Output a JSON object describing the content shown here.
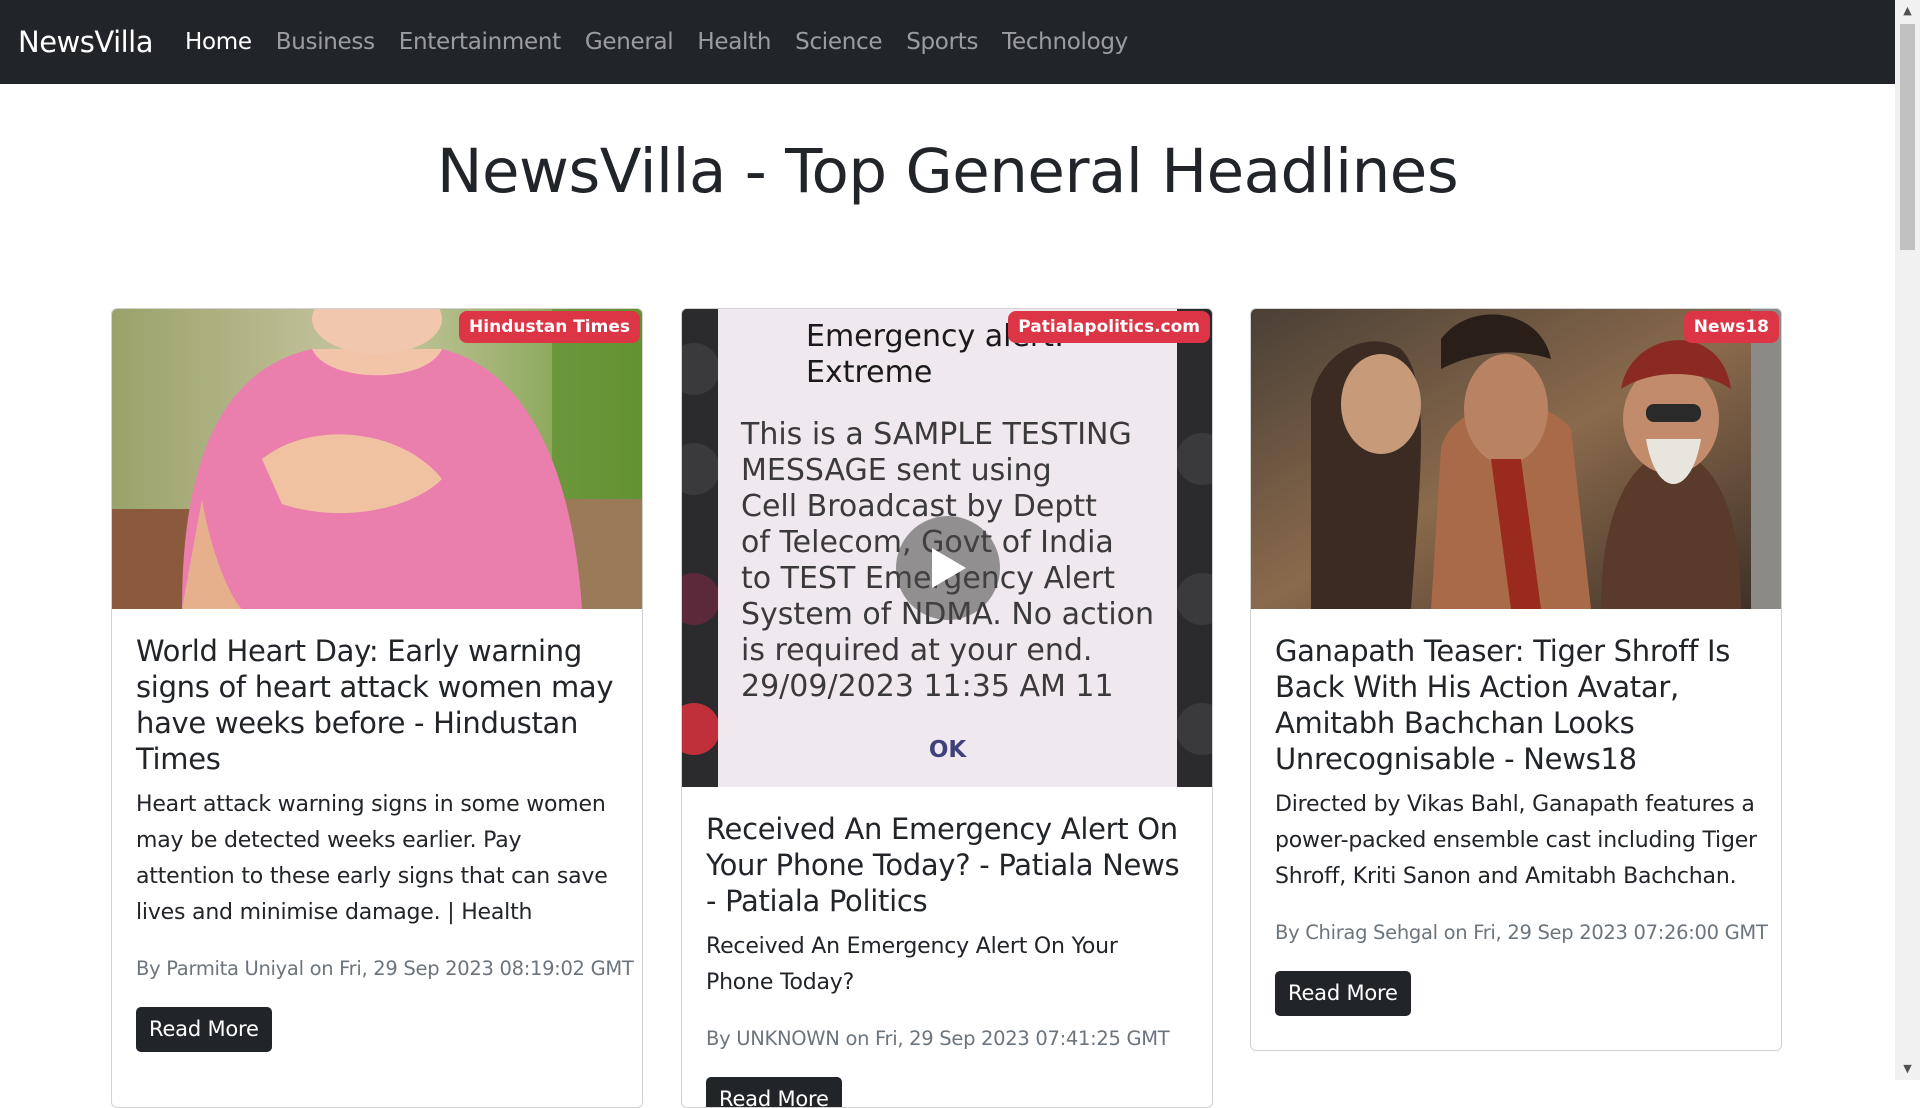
{
  "navbar": {
    "brand": "NewsVilla",
    "items": [
      {
        "label": "Home",
        "active": true
      },
      {
        "label": "Business"
      },
      {
        "label": "Entertainment"
      },
      {
        "label": "General"
      },
      {
        "label": "Health"
      },
      {
        "label": "Science"
      },
      {
        "label": "Sports"
      },
      {
        "label": "Technology"
      }
    ]
  },
  "page_title": "NewsVilla - Top General Headlines",
  "articles": [
    {
      "source": "Hindustan Times",
      "title": "World Heart Day: Early warning signs of heart attack women may have weeks before - Hindustan Times",
      "description": "Heart attack warning signs in some women may be detected weeks earlier. Pay attention to these early signs that can save lives and minimise damage. | Health",
      "meta": "By Parmita Uniyal on Fri, 29 Sep 2023 08:19:02 GMT",
      "button": "Read More"
    },
    {
      "source": "Patialapolitics.com",
      "title": "Received An Emergency Alert On Your Phone Today? - Patiala News - Patiala Politics",
      "description": "Received An Emergency Alert On Your Phone Today?",
      "meta": "By UNKNOWN on Fri, 29 Sep 2023 07:41:25 GMT",
      "button": "Read More",
      "image_text": {
        "heading": "Emergency alert:\nExtreme",
        "body": "This is a SAMPLE TESTING\nMESSAGE sent using\nCell Broadcast by Deptt\nof Telecom, Govt of India\nto TEST Emergency Alert\nSystem of NDMA. No action\nis required at your end.\n29/09/2023 11:35 AM 11",
        "ok": "OK"
      }
    },
    {
      "source": "News18",
      "title": "Ganapath Teaser: Tiger Shroff Is Back With His Action Avatar, Amitabh Bachchan Looks Unrecognisable - News18",
      "description": "Directed by Vikas Bahl, Ganapath features a power-packed ensemble cast including Tiger Shroff, Kriti Sanon and Amitabh Bachchan.",
      "meta": "By Chirag Sehgal on Fri, 29 Sep 2023 07:26:00 GMT",
      "button": "Read More"
    }
  ],
  "colors": {
    "navbar": "#212529",
    "badge": "#dc3545",
    "button": "#212529",
    "muted_text": "#6c757d"
  }
}
